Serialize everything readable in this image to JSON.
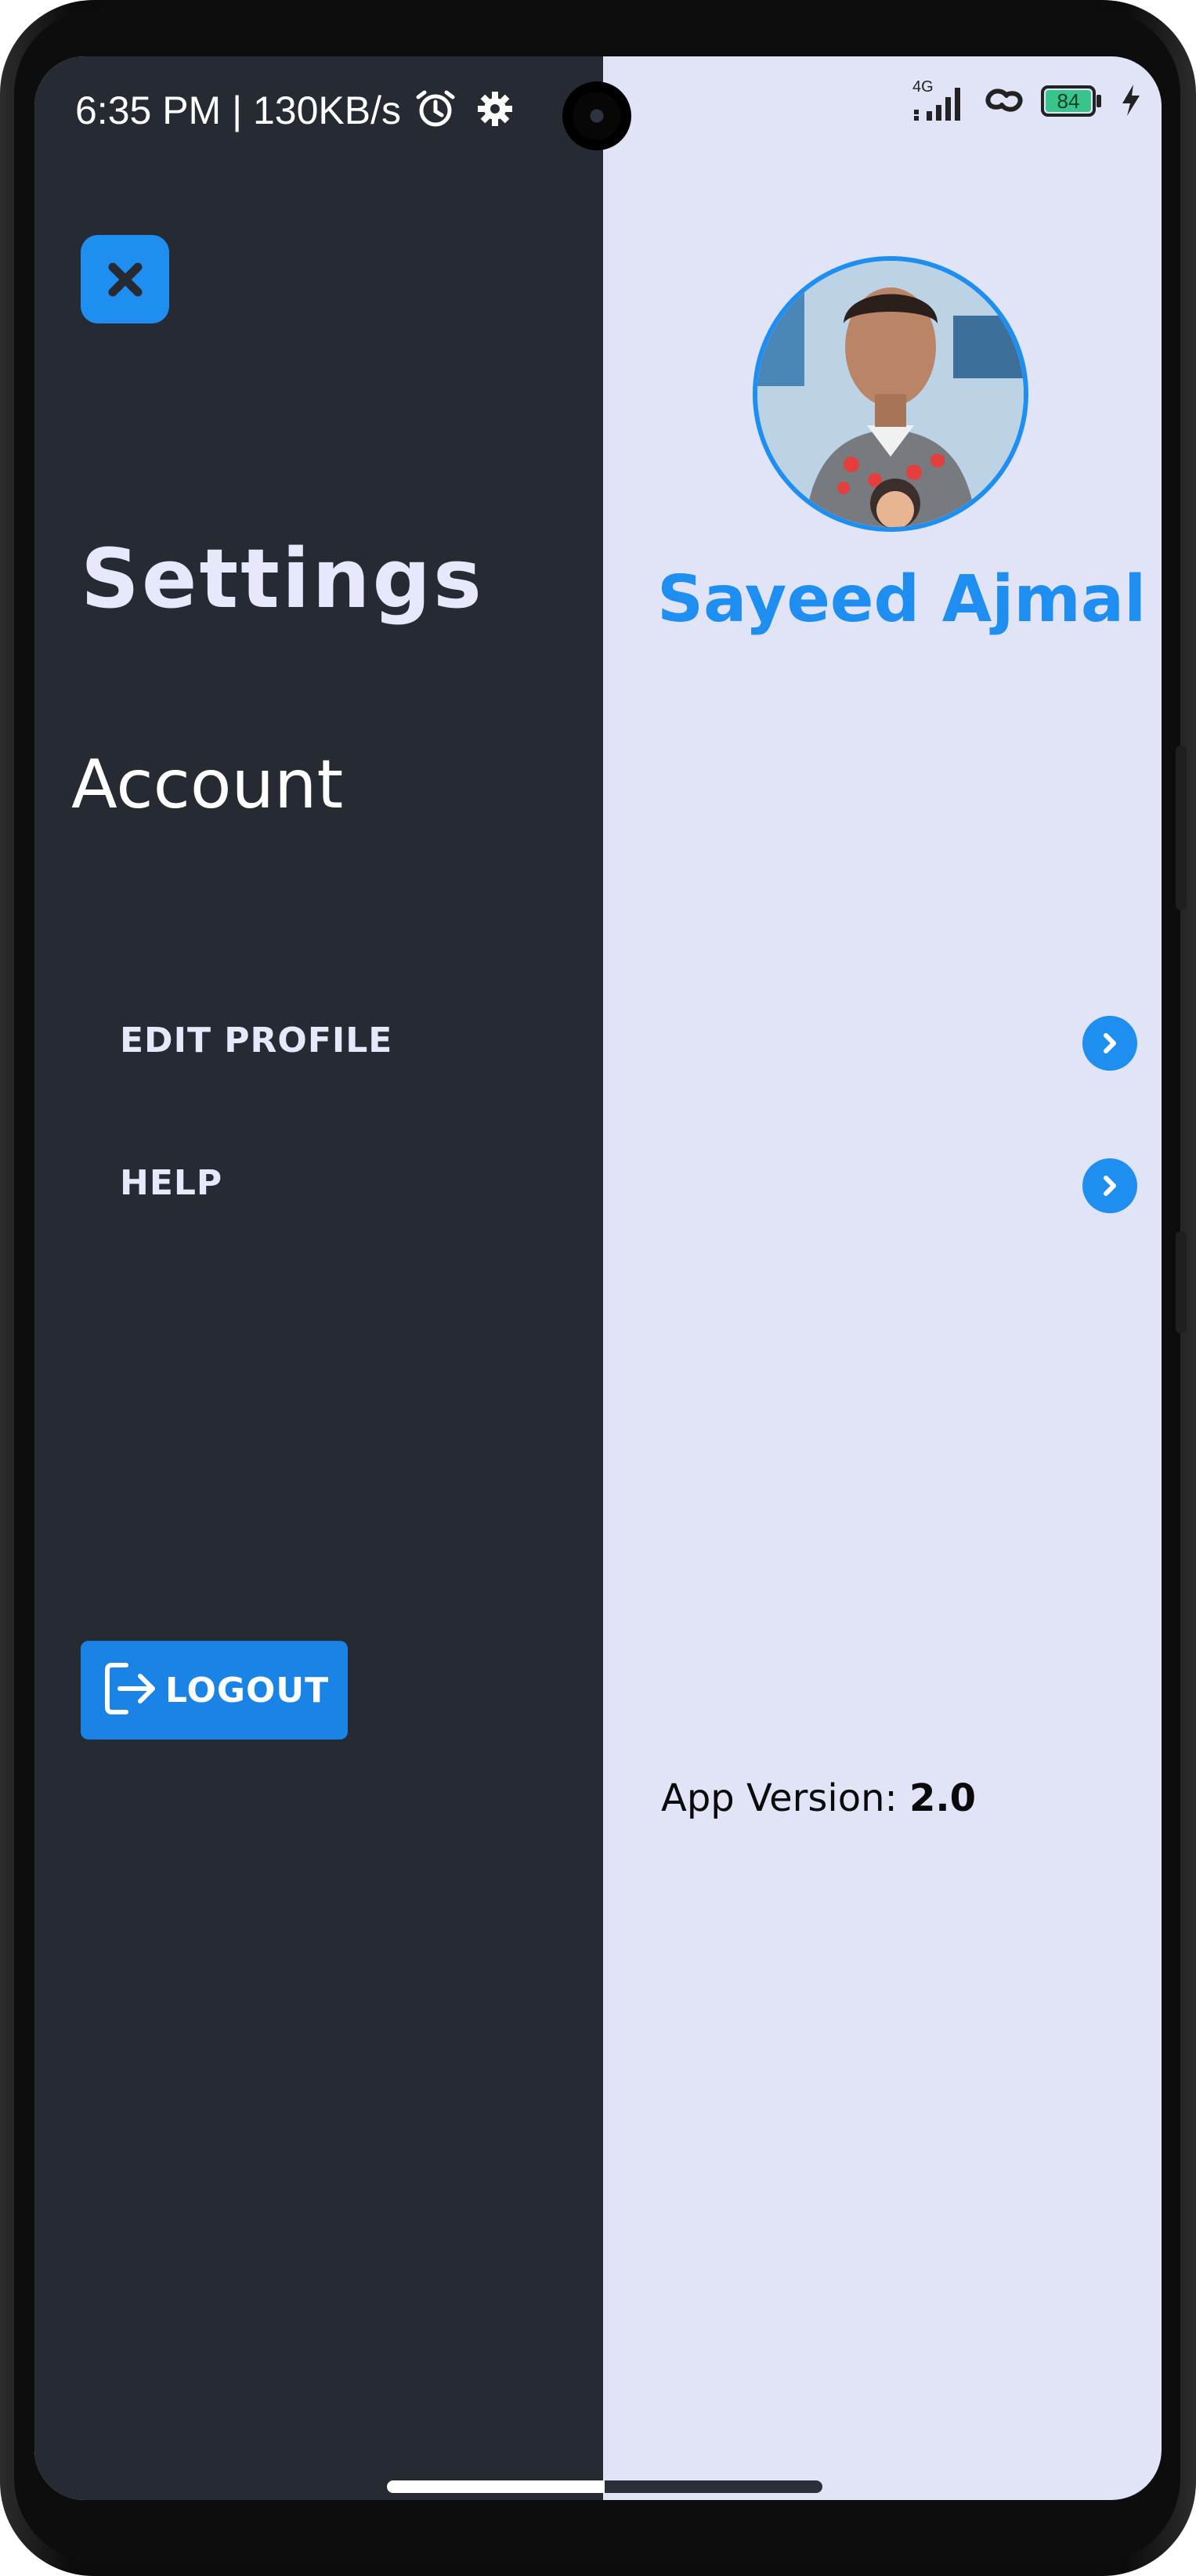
{
  "status_bar": {
    "time_speed": "6:35 PM | 130KB/s",
    "network": "4G",
    "battery": "84",
    "icons": [
      "alarm-icon",
      "settings-gear-icon",
      "signal-icon",
      "link-icon",
      "battery-icon",
      "charging-icon"
    ]
  },
  "page": {
    "title": "Settings",
    "section_title": "Account",
    "close_icon": "close-icon"
  },
  "menu": {
    "items": [
      {
        "label": "EDIT PROFILE",
        "icon": "chevron-right-icon"
      },
      {
        "label": "HELP",
        "icon": "chevron-right-icon"
      }
    ]
  },
  "logout": {
    "label": "LOGOUT",
    "icon": "logout-icon"
  },
  "profile": {
    "name": "Sayeed Ajmal"
  },
  "footer": {
    "version_label": "App Version: ",
    "version_number": "2.0"
  },
  "colors": {
    "accent": "#1e8ef0",
    "left_panel": "#252a33",
    "right_panel": "#e1e3f7",
    "title_text": "#e7e8fb"
  }
}
